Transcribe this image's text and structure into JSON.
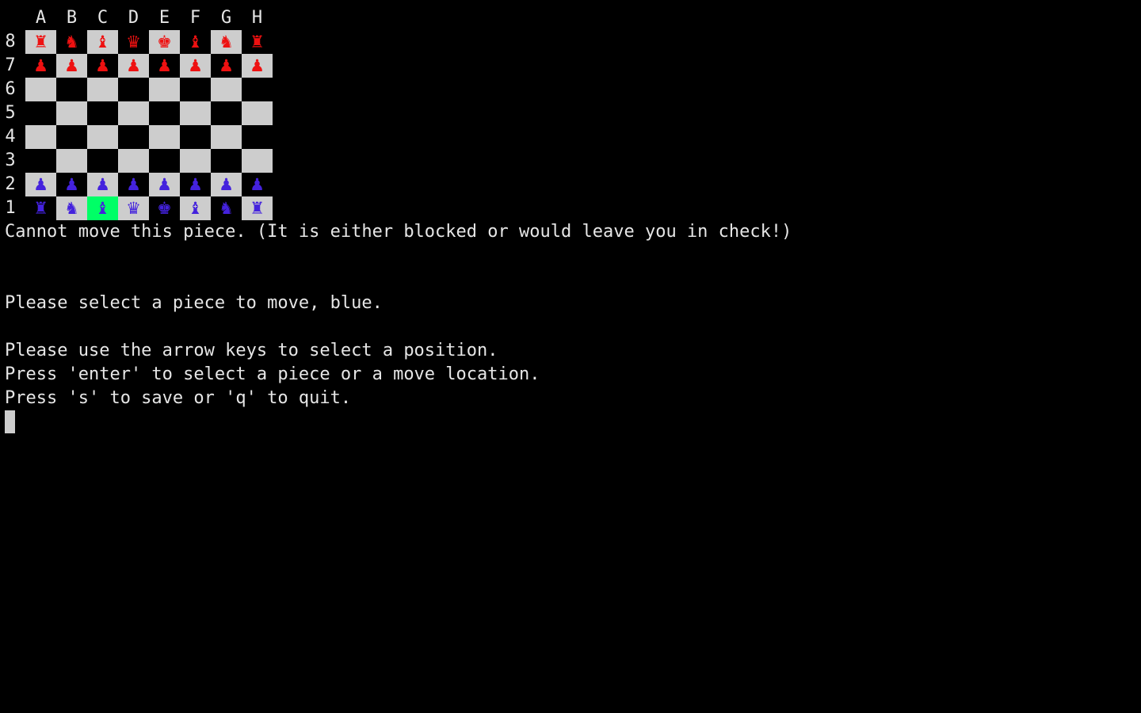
{
  "colors": {
    "background": "#000000",
    "text": "#e6e6e6",
    "light_square": "#cdcdcd",
    "dark_square": "#000000",
    "selected_square": "#00ff66",
    "red_pieces": "#ee1111",
    "blue_pieces": "#4422dd"
  },
  "board": {
    "files": [
      "A",
      "B",
      "C",
      "D",
      "E",
      "F",
      "G",
      "H"
    ],
    "ranks": [
      "8",
      "7",
      "6",
      "5",
      "4",
      "3",
      "2",
      "1"
    ],
    "selected": "C1",
    "rows": [
      [
        "♜",
        "♞",
        "♝",
        "♛",
        "♚",
        "♝",
        "♞",
        "♜"
      ],
      [
        "♟",
        "♟",
        "♟",
        "♟",
        "♟",
        "♟",
        "♟",
        "♟"
      ],
      [
        "",
        "",
        "",
        "",
        "",
        "",
        "",
        ""
      ],
      [
        "",
        "",
        "",
        "",
        "",
        "",
        "",
        ""
      ],
      [
        "",
        "",
        "",
        "",
        "",
        "",
        "",
        ""
      ],
      [
        "",
        "",
        "",
        "",
        "",
        "",
        "",
        ""
      ],
      [
        "♟",
        "♟",
        "♟",
        "♟",
        "♟",
        "♟",
        "♟",
        "♟"
      ],
      [
        "♜",
        "♞",
        "♝",
        "♛",
        "♚",
        "♝",
        "♞",
        "♜"
      ]
    ],
    "owners": [
      [
        "red",
        "red",
        "red",
        "red",
        "red",
        "red",
        "red",
        "red"
      ],
      [
        "red",
        "red",
        "red",
        "red",
        "red",
        "red",
        "red",
        "red"
      ],
      [
        "",
        "",
        "",
        "",
        "",
        "",
        "",
        ""
      ],
      [
        "",
        "",
        "",
        "",
        "",
        "",
        "",
        ""
      ],
      [
        "",
        "",
        "",
        "",
        "",
        "",
        "",
        ""
      ],
      [
        "",
        "",
        "",
        "",
        "",
        "",
        "",
        ""
      ],
      [
        "blue",
        "blue",
        "blue",
        "blue",
        "blue",
        "blue",
        "blue",
        "blue"
      ],
      [
        "blue",
        "blue",
        "blue",
        "blue",
        "blue",
        "blue",
        "blue",
        "blue"
      ]
    ]
  },
  "messages": {
    "error": "Cannot move this piece. (It is either blocked or would leave you in check!)",
    "prompt": "Please select a piece to move, blue.",
    "help_arrows": "Please use the arrow keys to select a position.",
    "help_enter": "Press 'enter' to select a piece or a move location.",
    "help_save_quit": "Press 's' to save or 'q' to quit."
  }
}
